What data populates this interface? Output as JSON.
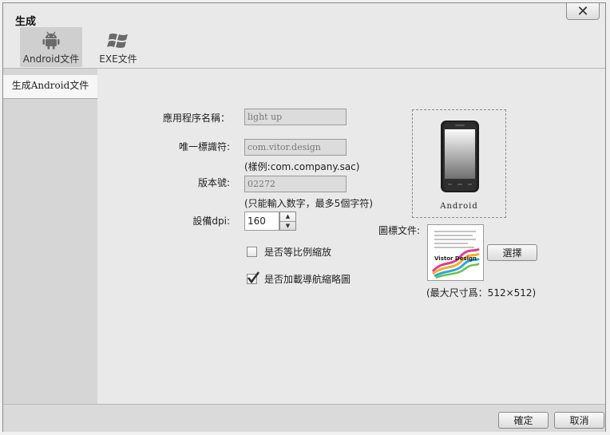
{
  "window": {
    "title": "生成",
    "close_glyph": "✕"
  },
  "tabs": [
    {
      "label": "Android文件",
      "icon": "android-icon",
      "selected": true
    },
    {
      "label": "EXE文件",
      "icon": "windows-icon",
      "selected": false
    }
  ],
  "sidebar": {
    "items": [
      {
        "label": "生成Android文件",
        "selected": true
      }
    ]
  },
  "form": {
    "app_name": {
      "label": "應用程序名稱：",
      "value": "light up"
    },
    "identifier": {
      "label": "唯一標識符:",
      "value": "com.vitor.design",
      "hint": "(樣例:com.company.sac)"
    },
    "version": {
      "label": "版本號:",
      "value": "02272",
      "hint": "(只能輸入数字，最多5個字符)"
    },
    "dpi": {
      "label": "設備dpi:",
      "value": "160"
    },
    "scale_checkbox": {
      "label": "是否等比例縮放",
      "checked": false
    },
    "nav_checkbox": {
      "label": "是否加載導航縮略圖",
      "checked": true
    }
  },
  "preview": {
    "caption": "Android"
  },
  "icon_file": {
    "label": "圖標文件:",
    "choose_label": "選擇",
    "hint": "(最大尺寸爲：512×512)",
    "thumb_text": "Vistor Design"
  },
  "footer": {
    "ok_label": "確定",
    "cancel_label": "取消"
  },
  "colors": {
    "panel": "#e9e9e9",
    "sidebar": "#d6d6d6",
    "selected_tab": "#cfcfcf",
    "disabled_field": "#dcdcdc"
  }
}
